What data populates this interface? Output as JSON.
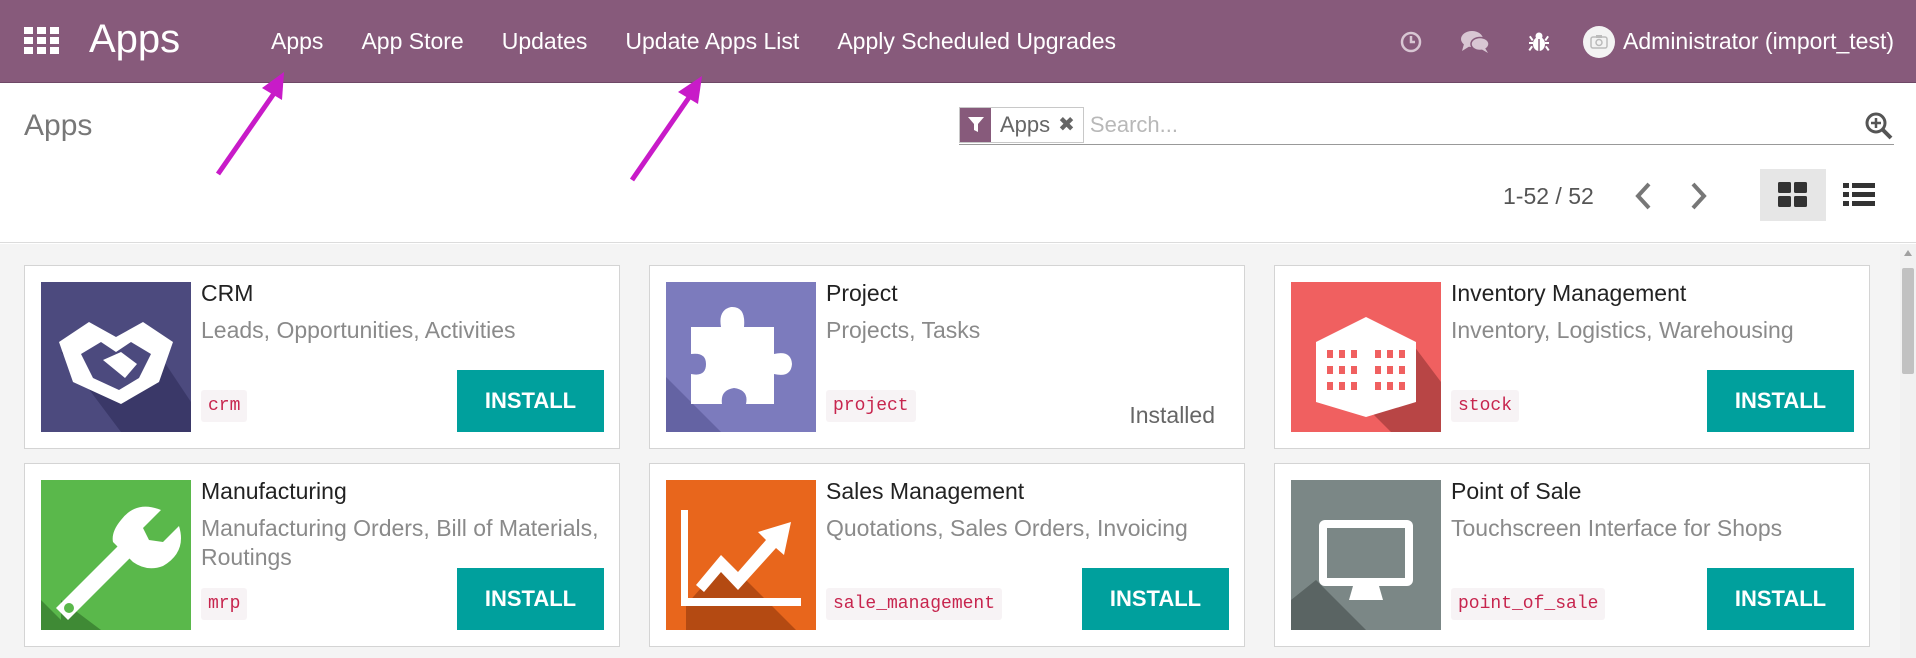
{
  "navbar": {
    "apps_icon": "grid-icon",
    "brand": "Apps",
    "menu": [
      "Apps",
      "App Store",
      "Updates",
      "Update Apps List",
      "Apply Scheduled Upgrades"
    ],
    "icons": [
      "clock-icon",
      "chat-icon",
      "bug-icon"
    ],
    "user": "Administrator (import_test)",
    "color": "#875a7b"
  },
  "control_panel": {
    "title": "Apps",
    "search": {
      "facet_label": "Apps",
      "facet_icon": "filter-icon",
      "placeholder": "Search..."
    },
    "pager": {
      "value": "1-52 / 52"
    },
    "views": [
      "kanban-view-icon",
      "list-view-icon"
    ],
    "active_view": "kanban"
  },
  "apps": [
    {
      "name": "CRM",
      "summary": "Leads, Opportunities, Activities",
      "technical": "crm",
      "action": "INSTALL",
      "icon": "handshake-icon",
      "color": "#4c4a7e"
    },
    {
      "name": "Project",
      "summary": "Projects, Tasks",
      "technical": "project",
      "status": "Installed",
      "icon": "puzzle-icon",
      "color": "#7c7bbd"
    },
    {
      "name": "Inventory Management",
      "summary": "Inventory, Logistics, Warehousing",
      "technical": "stock",
      "action": "INSTALL",
      "icon": "warehouse-icon",
      "color": "#f06060"
    },
    {
      "name": "Manufacturing",
      "summary": "Manufacturing Orders, Bill of Materials, Routings",
      "technical": "mrp",
      "action": "INSTALL",
      "icon": "wrench-icon",
      "color": "#5ab84b"
    },
    {
      "name": "Sales Management",
      "summary": "Quotations, Sales Orders, Invoicing",
      "technical": "sale_management",
      "action": "INSTALL",
      "icon": "trend-chart-icon",
      "color": "#e8661c"
    },
    {
      "name": "Point of Sale",
      "summary": "Touchscreen Interface for Shops",
      "technical": "point_of_sale",
      "action": "INSTALL",
      "icon": "monitor-icon",
      "color": "#7b8786"
    }
  ],
  "colors": {
    "install_button": "#00a09d",
    "technical_name": "#c7254e",
    "annotation_arrow": "#c81bc8"
  }
}
